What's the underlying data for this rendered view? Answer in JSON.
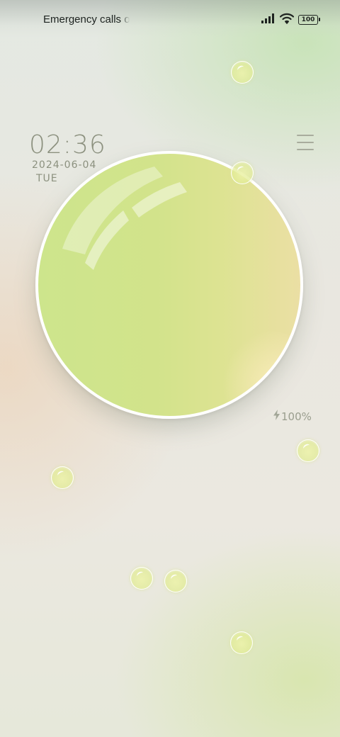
{
  "status_bar": {
    "carrier_text": "Emergency calls o",
    "signal_icon": "signal-bars-icon",
    "wifi_icon": "wifi-icon",
    "battery_level": "100"
  },
  "lock_screen": {
    "time": "02:36",
    "date": "2024-06-04",
    "weekday": "TUE",
    "menu_icon": "menu-icon",
    "charging_icon": "lightning-icon",
    "charge_level": "100%"
  },
  "colors": {
    "orb_green": "#cde58c",
    "orb_edge_yellow": "#ebdfa4",
    "clock_text": "#8c917f",
    "bubble": "#e2ec96"
  }
}
